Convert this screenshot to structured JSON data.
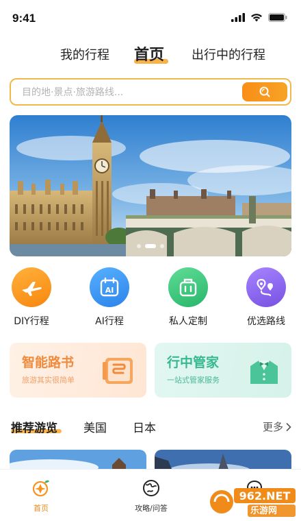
{
  "status_bar": {
    "time": "9:41"
  },
  "top_tabs": {
    "mine": "我的行程",
    "home": "首页",
    "traveling": "出行中的行程"
  },
  "search": {
    "placeholder": "目的地·景点·旅游路线..."
  },
  "banner": {
    "slide_count": 3,
    "active_slide": 2
  },
  "quick_actions": [
    {
      "label": "DIY行程",
      "icon": "airplane-icon",
      "color": "#f7931e"
    },
    {
      "label": "AI行程",
      "icon": "ai-calendar-icon",
      "color": "#2f8ff0"
    },
    {
      "label": "私人定制",
      "icon": "suitcase-icon",
      "color": "#36c37d"
    },
    {
      "label": "优选路线",
      "icon": "route-pin-icon",
      "color": "#8a63e8"
    }
  ],
  "feature_cards": {
    "guide": {
      "title": "智能路书",
      "subtitle": "旅游其实很简单"
    },
    "butler": {
      "title": "行中管家",
      "subtitle": "一站式管家服务"
    }
  },
  "recommend": {
    "tabs": [
      "推荐游览",
      "美国",
      "日本"
    ],
    "more": "更多"
  },
  "bottom_nav": {
    "home": "首页",
    "guide": "攻略/问答"
  },
  "watermark": {
    "brand": "962.NET",
    "sub": "乐游网"
  },
  "colors": {
    "accent": "#f7931e",
    "search_border": "#f1b84a"
  }
}
